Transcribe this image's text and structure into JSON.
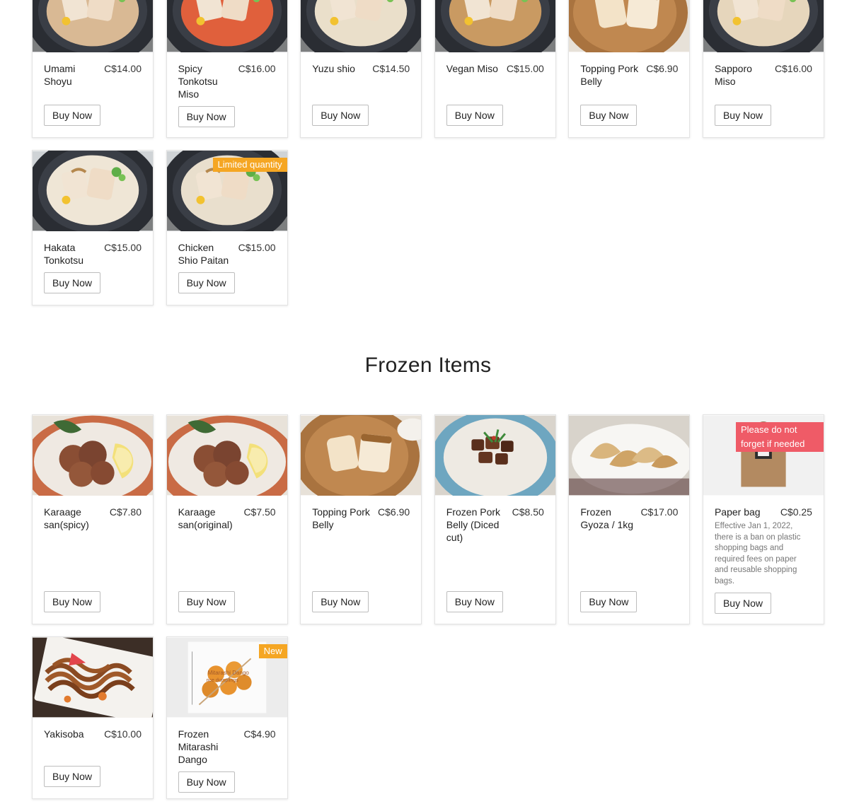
{
  "ramen": {
    "items": [
      {
        "name": "Umami Shoyu",
        "price": "C$14.00",
        "button": "Buy Now",
        "image": "shoyu-ramen-bowl"
      },
      {
        "name": "Spicy Tonkotsu Miso",
        "price": "C$16.00",
        "button": "Buy Now",
        "image": "spicy-ramen-bowl"
      },
      {
        "name": "Yuzu shio",
        "price": "C$14.50",
        "button": "Buy Now",
        "image": "shio-ramen-bowl"
      },
      {
        "name": "Vegan Miso",
        "price": "C$15.00",
        "button": "Buy Now",
        "image": "vegan-ramen-bowl"
      },
      {
        "name": "Topping Pork Belly",
        "price": "C$6.90",
        "button": "Buy Now",
        "image": "pork-belly-plate"
      },
      {
        "name": "Sapporo Miso",
        "price": "C$16.00",
        "button": "Buy Now",
        "image": "sapporo-ramen-bowl"
      },
      {
        "name": "Hakata Tonkotsu",
        "price": "C$15.00",
        "button": "Buy Now",
        "image": "hakata-ramen-bowl"
      },
      {
        "name": "Chicken Shio Paitan",
        "price": "C$15.00",
        "button": "Buy Now",
        "badge": "Limited quantity",
        "image": "chicken-ramen-bowl"
      }
    ]
  },
  "frozen": {
    "title": "Frozen Items",
    "items": [
      {
        "name": "Karaage san(spicy)",
        "price": "C$7.80",
        "button": "Buy Now",
        "image": "karaage-plate"
      },
      {
        "name": "Karaage san(original)",
        "price": "C$7.50",
        "button": "Buy Now",
        "image": "karaage-plate"
      },
      {
        "name": "Topping Pork Belly",
        "price": "C$6.90",
        "button": "Buy Now",
        "image": "pork-belly-plate"
      },
      {
        "name": "Frozen Pork Belly (Diced cut)",
        "price": "C$8.50",
        "button": "Buy Now",
        "image": "diced-pork-rice"
      },
      {
        "name": "Frozen Gyoza / 1kg",
        "price": "C$17.00",
        "button": "Buy Now",
        "image": "gyoza-plate"
      },
      {
        "name": "Paper bag",
        "price": "C$0.25",
        "button": "Buy Now",
        "badge": "Please do not forget if needed",
        "description": "Effective Jan 1, 2022, there is a ban on plastic shopping bags and required fees on paper and reusable shopping bags.",
        "image": "paper-bag"
      },
      {
        "name": "Yakisoba",
        "price": "C$10.00",
        "button": "Buy Now",
        "image": "yakisoba-plate"
      },
      {
        "name": "Frozen Mitarashi Dango",
        "price": "C$4.90",
        "button": "Buy Now",
        "badge": "New",
        "package_text": "Mitarashi Dango",
        "package_subtext": "rice dumplings",
        "image": "dango-package"
      }
    ]
  },
  "colors": {
    "badge_orange": "#f5a623",
    "badge_red": "#ef5b67"
  }
}
